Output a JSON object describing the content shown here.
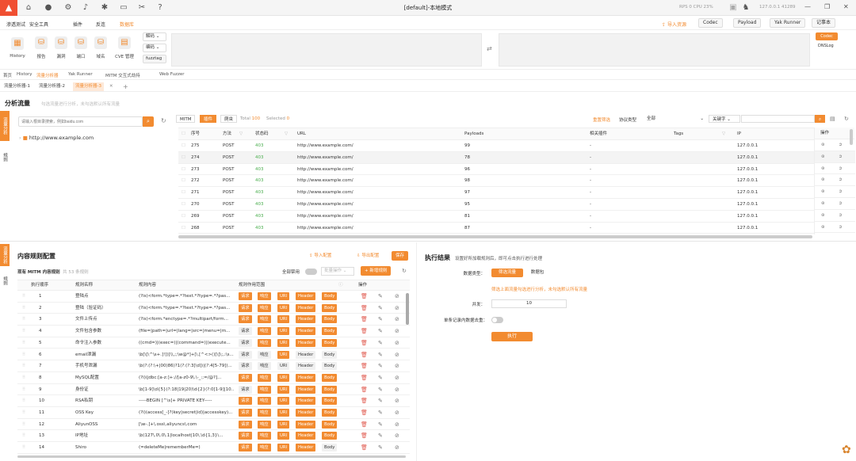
{
  "window": {
    "title": "[default]-本地模式",
    "rps": "RPS 0   CPU 23%",
    "ip": "127.0.0.1   41289",
    "close": "✕",
    "max": "❐",
    "min": "—"
  },
  "menu": {
    "items": [
      "渗透测试",
      "安全工具",
      "插件",
      "反连",
      "数据库"
    ],
    "import": "导入资源",
    "codec": "Codec",
    "payload": "Payload",
    "yakrunner": "Yak Runner",
    "notes": "记事本"
  },
  "toolbar": {
    "tools": [
      "History",
      "报告",
      "漏洞",
      "端口",
      "域名",
      "CVE 管理"
    ],
    "decode": "解码",
    "encode": "编码",
    "fuzztag": "fuzztag",
    "codec_btn": "Codec",
    "dnslog": "DNSLog"
  },
  "tabs1": [
    "首页",
    "History",
    "流量分析器",
    "Yak Runner",
    "MITM 交互式劫持",
    "Web Fuzzer"
  ],
  "tabs2": [
    "流量分析器-1",
    "流量分析器-2",
    "流量分析器-3"
  ],
  "analysis": {
    "title": "分析流量",
    "subtitle": "勾选流量进行分析，未勾选默认所有流量",
    "search_placeholder": "请输入根目录搜索，例如baidu.com",
    "tree_node": "http://www.example.com"
  },
  "vtabs": [
    "流量分析",
    "规则"
  ],
  "flow": {
    "seg": [
      "MITM",
      "插件",
      "爬虫"
    ],
    "total_label": "Total",
    "total": "100",
    "selected_label": "Selected",
    "selected": "0",
    "reset": "重置筛选",
    "proto_label": "协议类型",
    "proto_value": "全部",
    "keyword": "关键字",
    "headers": [
      "序号",
      "方法",
      "状态码",
      "URL",
      "Payloads",
      "相关插件",
      "Tags",
      "IP",
      "操作"
    ],
    "rows": [
      [
        "275",
        "POST",
        "403",
        "http://www.example.com/",
        "99",
        "-",
        "",
        "127.0.0.1"
      ],
      [
        "274",
        "POST",
        "403",
        "http://www.example.com/",
        "78",
        "-",
        "",
        "127.0.0.1"
      ],
      [
        "273",
        "POST",
        "403",
        "http://www.example.com/",
        "96",
        "-",
        "",
        "127.0.0.1"
      ],
      [
        "272",
        "POST",
        "403",
        "http://www.example.com/",
        "98",
        "-",
        "",
        "127.0.0.1"
      ],
      [
        "271",
        "POST",
        "403",
        "http://www.example.com/",
        "97",
        "-",
        "",
        "127.0.0.1"
      ],
      [
        "270",
        "POST",
        "403",
        "http://www.example.com/",
        "95",
        "-",
        "",
        "127.0.0.1"
      ],
      [
        "269",
        "POST",
        "403",
        "http://www.example.com/",
        "81",
        "-",
        "",
        "127.0.0.1"
      ],
      [
        "268",
        "POST",
        "403",
        "http://www.example.com/",
        "87",
        "-",
        "",
        "127.0.0.1"
      ]
    ]
  },
  "rules": {
    "title": "内容规则配置",
    "import": "导入配置",
    "export": "导出配置",
    "save": "保存",
    "sub_prefix": "现有 MITM 内容规则",
    "count": "共 53 条规则",
    "disable_all": "全部禁用",
    "batch": "批量操作",
    "add": "新增规则",
    "headers": [
      "执行顺序",
      "规则名称",
      "规则内容",
      "规则作用范围",
      "操作"
    ],
    "scope": [
      "请求",
      "响应",
      "URI",
      "Header",
      "Body"
    ],
    "rows": [
      [
        "1",
        "登陆点",
        "(?is)<form.*type=.*?text.*?type=.*?pas...",
        "11111"
      ],
      [
        "2",
        "登陆（验证码）",
        "(?is)<form.*type=.*?text.*?type=.*?pas...",
        "11111"
      ],
      [
        "3",
        "文件上传点",
        "(?is)<form.*enctype=.*?multipart/form...",
        "11111"
      ],
      [
        "4",
        "文件包含参数",
        "(file=|path=|url=|lang=|src=|menu=|m...",
        "01111"
      ],
      [
        "5",
        "命令注入参数",
        "((cmd=)|(exec=)|(command=)|(execute...",
        "01111"
      ],
      [
        "6",
        "email泄漏",
        "\\b[\\[\\^\\s+.]!])[\\\\,;;\\w@*]+[\\.[^<>()[\\]\\;,:\\s...",
        "00100"
      ],
      [
        "7",
        "手机号泄漏",
        "\\b(?:(?:\\+|00)86)?1(?:(?:3[\\d])|(?:4[5-79])...",
        "00000"
      ],
      [
        "8",
        "MySQL配置",
        "(?i)(jdbc:[a-z:]+://[a-z0-9\\.\\-_:;=/@?]...",
        "11111"
      ],
      [
        "9",
        "身份证",
        "\\b[1-9]\\d{5}(?:18|19|20)\\d{2}(?:0[1-9]|10...",
        "01111"
      ],
      [
        "10",
        "RSA私钥",
        "-----BEGIN [^\\s]+ PRIVATE KEY-----",
        "11111"
      ],
      [
        "11",
        "OSS Key",
        "(?i)(access[_-]?(key|secret|id)|accesskey)...",
        "11111"
      ],
      [
        "12",
        "AliyunOSS",
        "[\\w-.]+\\.oss\\.aliyuncs\\.com",
        "11111"
      ],
      [
        "13",
        "IP地址",
        "\\b(127\\.0\\.0\\.1|localhost|10\\.\\d{1,3}\\...",
        "11111"
      ],
      [
        "14",
        "Shiro",
        "(=deleteMe|rememberMe=)",
        "11110"
      ]
    ]
  },
  "exec": {
    "title": "执行结果",
    "subtitle": "设置好所加载规则后，即可点击执行进行处理",
    "dtype_label": "数据类型：",
    "dtype_a": "筛选流量",
    "dtype_b": "数据包",
    "note": "筛选上面流量勾选进行分析，未勾选默认所有流量",
    "conc_label": "并发：",
    "conc": "10",
    "dedup_label": "单条记录内数据去重：",
    "run": "执行"
  }
}
